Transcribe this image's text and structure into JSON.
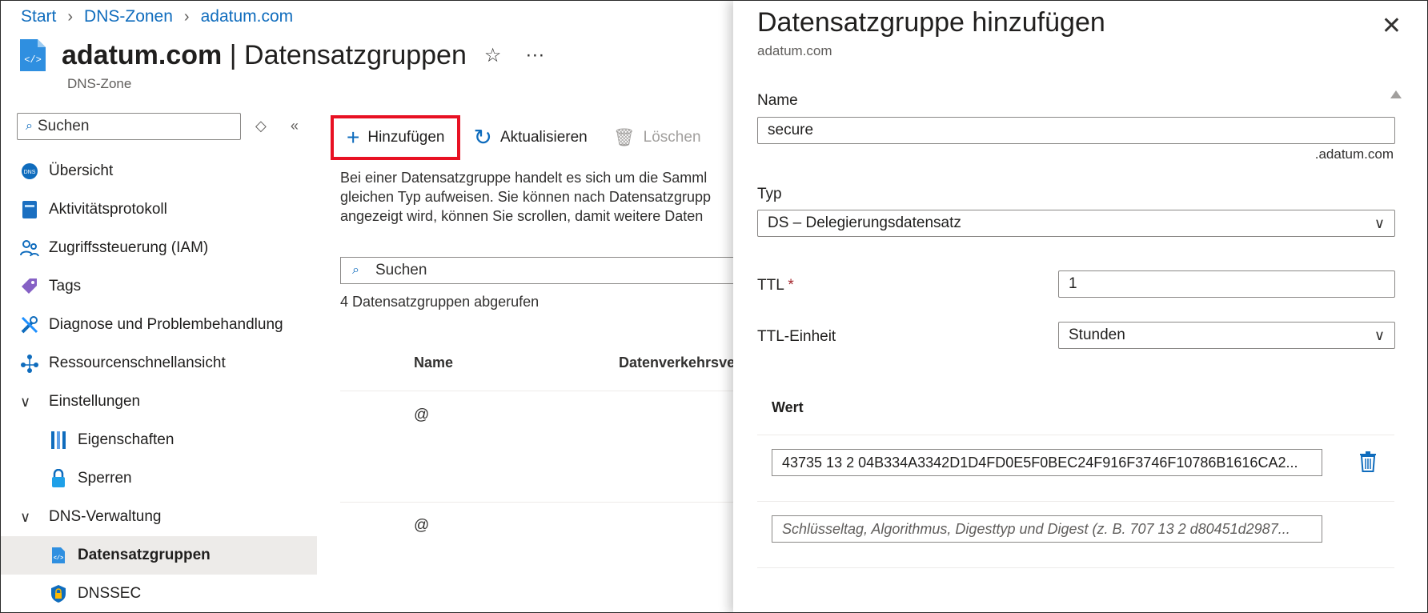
{
  "breadcrumb": {
    "items": [
      "Start",
      "DNS-Zonen",
      "adatum.com"
    ]
  },
  "header": {
    "resource": "adatum.com",
    "separator": "|",
    "section": "Datensatzgruppen",
    "subtitle": "DNS-Zone",
    "star_icon": "star-icon",
    "more": "···"
  },
  "sidebar": {
    "search_placeholder": "Suchen",
    "items": [
      {
        "label": "Übersicht",
        "icon": "dns-overview-icon"
      },
      {
        "label": "Aktivitätsprotokoll",
        "icon": "activity-log-icon"
      },
      {
        "label": "Zugriffssteuerung (IAM)",
        "icon": "iam-icon"
      },
      {
        "label": "Tags",
        "icon": "tag-icon"
      },
      {
        "label": "Diagnose und Problembehandlung",
        "icon": "wrench-icon"
      },
      {
        "label": "Ressourcenschnellansicht",
        "icon": "resource-visualizer-icon"
      },
      {
        "label": "Einstellungen",
        "icon": "chevron-down-icon"
      },
      {
        "label": "Eigenschaften",
        "icon": "properties-icon"
      },
      {
        "label": "Sperren",
        "icon": "lock-icon"
      },
      {
        "label": "DNS-Verwaltung",
        "icon": "chevron-down-icon"
      },
      {
        "label": "Datensatzgruppen",
        "icon": "record-sets-icon"
      },
      {
        "label": "DNSSEC",
        "icon": "shield-lock-icon"
      }
    ]
  },
  "toolbar": {
    "add": "Hinzufügen",
    "refresh": "Aktualisieren",
    "delete": "Löschen"
  },
  "main": {
    "description": "Bei einer Datensatzgruppe handelt es sich um die Samml\ngleichen Typ aufweisen. Sie können nach Datensatzgrupp\nangezeigt wird, können Sie scrollen, damit weitere Daten",
    "search_placeholder": "Suchen",
    "count_text": "4 Datensatzgruppen abgerufen",
    "columns": [
      "Name",
      "Datenverkehrsve"
    ],
    "rows": [
      {
        "name": "@"
      },
      {
        "name": "@"
      }
    ]
  },
  "panel": {
    "title": "Datensatzgruppe hinzufügen",
    "subtitle": "adatum.com",
    "name_label": "Name",
    "name_value": "secure",
    "name_suffix": ".adatum.com",
    "type_label": "Typ",
    "type_value": "DS – Delegierungsdatensatz",
    "ttl_label": "TTL",
    "ttl_required": "*",
    "ttl_value": "1",
    "ttl_unit_label": "TTL-Einheit",
    "ttl_unit_value": "Stunden",
    "value_header": "Wert",
    "value_1": "43735 13 2 04B334A3342D1D4FD0E5F0BEC24F916F3746F10786B1616CA2...",
    "value_placeholder": "Schlüsseltag, Algorithmus, Digesttyp und Digest (z. B. 707 13 2 d80451d2987..."
  },
  "colors": {
    "accent": "#0f6cbd",
    "highlight_border": "#e81123",
    "required": "#a4262c"
  }
}
